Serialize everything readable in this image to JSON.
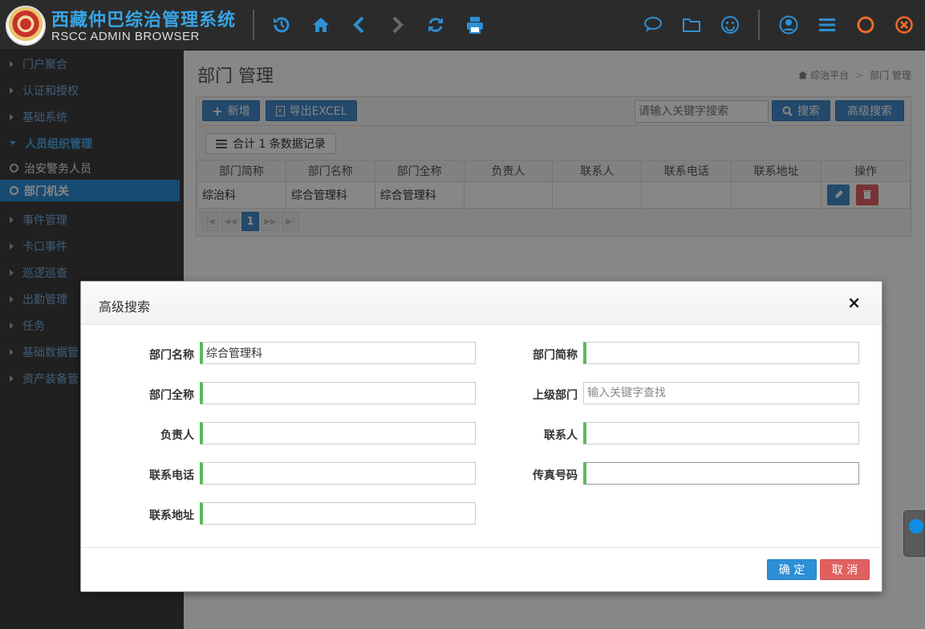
{
  "app": {
    "title": "西藏仲巴综治管理系统",
    "subtitle": "RSCC ADMIN BROWSER"
  },
  "toolbar_icons": [
    "history-icon",
    "home-icon",
    "back-icon",
    "forward-icon",
    "refresh-icon",
    "print-icon",
    "chat-icon",
    "folder-icon",
    "smiley-icon",
    "user-icon",
    "menu-icon",
    "circle-icon",
    "close-circle-icon"
  ],
  "colors": {
    "accent": "#2d8fd6",
    "danger": "#e06060",
    "success": "#5cb85c",
    "orange": "#f06a2a"
  },
  "sidebar": {
    "items": [
      {
        "label": "门户聚合"
      },
      {
        "label": "认证和授权"
      },
      {
        "label": "基础系统"
      },
      {
        "label": "人员组织管理"
      },
      {
        "label": "事件管理"
      },
      {
        "label": "卡口事件"
      },
      {
        "label": "巡逻巡查"
      },
      {
        "label": "出勤管理"
      },
      {
        "label": "任务"
      },
      {
        "label": "基础数据管"
      },
      {
        "label": "资产装备管"
      }
    ],
    "subitems": [
      {
        "label": "治安警务人员"
      },
      {
        "label": "部门机关"
      }
    ]
  },
  "page": {
    "title": "部门 管理",
    "breadcrumb_root": "综治平台",
    "breadcrumb_sep": ">",
    "breadcrumb_current": "部门 管理"
  },
  "toolbar": {
    "add_label": "新增",
    "export_label": "导出EXCEL",
    "search_placeholder": "请输入关键字搜索",
    "search_label": "搜索",
    "advanced_label": "高级搜索",
    "count_label": "合计 1 条数据记录"
  },
  "table": {
    "columns": [
      "部门简称",
      "部门名称",
      "部门全称",
      "负责人",
      "联系人",
      "联系电话",
      "联系地址",
      "操作"
    ],
    "rows": [
      [
        "综治科",
        "综合管理科",
        "综合管理科",
        "",
        "",
        "",
        "",
        ""
      ]
    ]
  },
  "pager": {
    "current": "1"
  },
  "modal": {
    "title": "高级搜索",
    "close": "×",
    "fields": {
      "dept_name": {
        "label": "部门名称",
        "value": "综合管理科"
      },
      "dept_short": {
        "label": "部门简称",
        "value": ""
      },
      "dept_full": {
        "label": "部门全称",
        "value": ""
      },
      "parent_dept": {
        "label": "上级部门",
        "value": "",
        "placeholder": "输入关键字查找"
      },
      "leader": {
        "label": "负责人",
        "value": ""
      },
      "contact": {
        "label": "联系人",
        "value": ""
      },
      "phone": {
        "label": "联系电话",
        "value": ""
      },
      "fax": {
        "label": "传真号码",
        "value": ""
      },
      "address": {
        "label": "联系地址",
        "value": ""
      }
    },
    "confirm_label": "确 定",
    "cancel_label": "取 消"
  }
}
